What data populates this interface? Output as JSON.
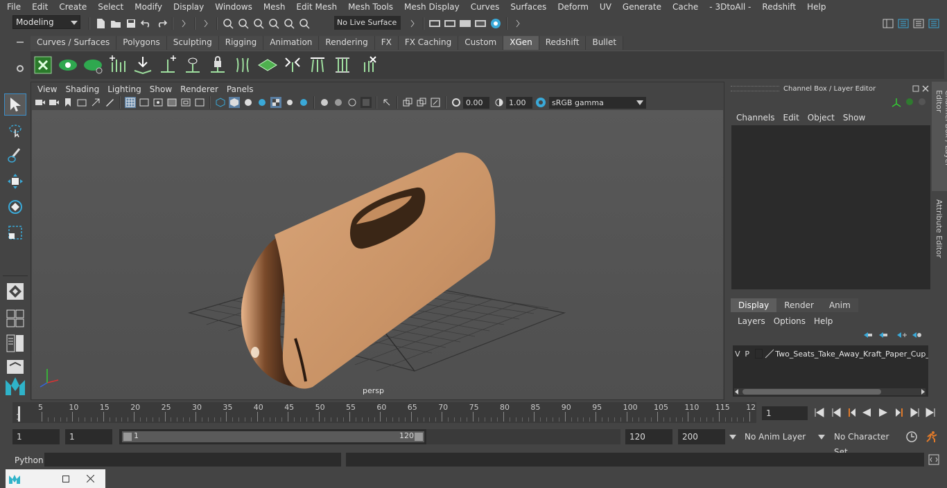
{
  "menu": [
    "File",
    "Edit",
    "Create",
    "Select",
    "Modify",
    "Display",
    "Windows",
    "Mesh",
    "Edit Mesh",
    "Mesh Tools",
    "Mesh Display",
    "Curves",
    "Surfaces",
    "Deform",
    "UV",
    "Generate",
    "Cache",
    "- 3DtoAll -",
    "Redshift",
    "Help"
  ],
  "status": {
    "mode": "Modeling",
    "live_surface": "No Live Surface"
  },
  "shelf_tabs": [
    "Curves / Surfaces",
    "Polygons",
    "Sculpting",
    "Rigging",
    "Animation",
    "Rendering",
    "FX",
    "FX Caching",
    "Custom",
    "XGen",
    "Redshift",
    "Bullet"
  ],
  "shelf_active": "XGen",
  "panel_menu": [
    "View",
    "Shading",
    "Lighting",
    "Show",
    "Renderer",
    "Panels"
  ],
  "panel_tools": {
    "exposure": "0.00",
    "gamma": "1.00",
    "color_space": "sRGB gamma"
  },
  "viewport": {
    "camera": "persp"
  },
  "channel_box": {
    "title": "Channel Box / Layer Editor",
    "menu": [
      "Channels",
      "Edit",
      "Object",
      "Show"
    ]
  },
  "layer_editor": {
    "tabs": [
      "Display",
      "Render",
      "Anim"
    ],
    "active_tab": "Display",
    "menu": [
      "Layers",
      "Options",
      "Help"
    ],
    "layer": {
      "v": "V",
      "p": "P",
      "name": "Two_Seats_Take_Away_Kraft_Paper_Cup_Ca"
    }
  },
  "side_tabs": {
    "channel": "Channel Box / Layer Editor",
    "attribute": "Attribute Editor"
  },
  "timeline": {
    "ticks": [
      "5",
      "10",
      "15",
      "20",
      "25",
      "30",
      "35",
      "40",
      "45",
      "50",
      "55",
      "60",
      "65",
      "70",
      "75",
      "80",
      "85",
      "90",
      "95",
      "100",
      "105",
      "110",
      "115",
      "12"
    ],
    "start_marker": "1",
    "current_frame": "1"
  },
  "range": {
    "start": "1",
    "playback_start": "1",
    "slider_start": "1",
    "slider_end": "120",
    "end": "120",
    "max": "200",
    "anim_layer": "No Anim Layer",
    "char_set": "No Character Set"
  },
  "command": {
    "label": "Python"
  }
}
